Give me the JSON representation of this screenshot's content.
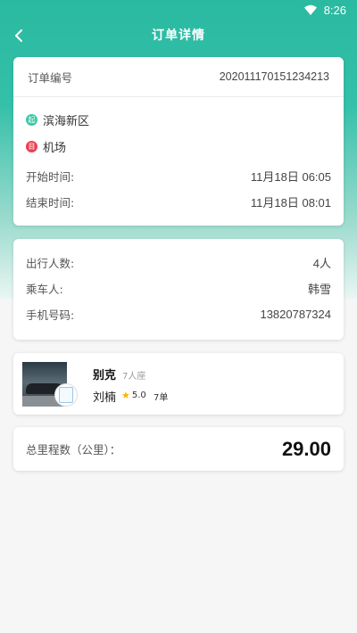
{
  "status_bar": {
    "time": "8:26"
  },
  "header": {
    "title": "订单详情"
  },
  "order": {
    "number_label": "订单编号",
    "number": "202011170151234213"
  },
  "route": {
    "start_icon_text": "起",
    "start": "滨海新区",
    "end_icon_text": "目",
    "end": "机场"
  },
  "times": {
    "start_label": "开始时间:",
    "start_value": "11月18日 06:05",
    "end_label": "结束时间:",
    "end_value": "11月18日 08:01"
  },
  "passenger": {
    "count_label": "出行人数:",
    "count_value": "4人",
    "rider_label": "乘车人:",
    "rider_value": "韩雪",
    "phone_label": "手机号码:",
    "phone_value": "13820787324"
  },
  "driver": {
    "car_brand": "别克",
    "car_seats": "7人座",
    "name": "刘楠",
    "rating": "5.0",
    "orders": "7单"
  },
  "mileage": {
    "label": "总里程数（公里）：",
    "value": "29.00"
  },
  "colors": {
    "accent": "#2ab9a1",
    "start": "#3ec9a7",
    "end": "#ef3d52",
    "star": "#f7b500"
  }
}
